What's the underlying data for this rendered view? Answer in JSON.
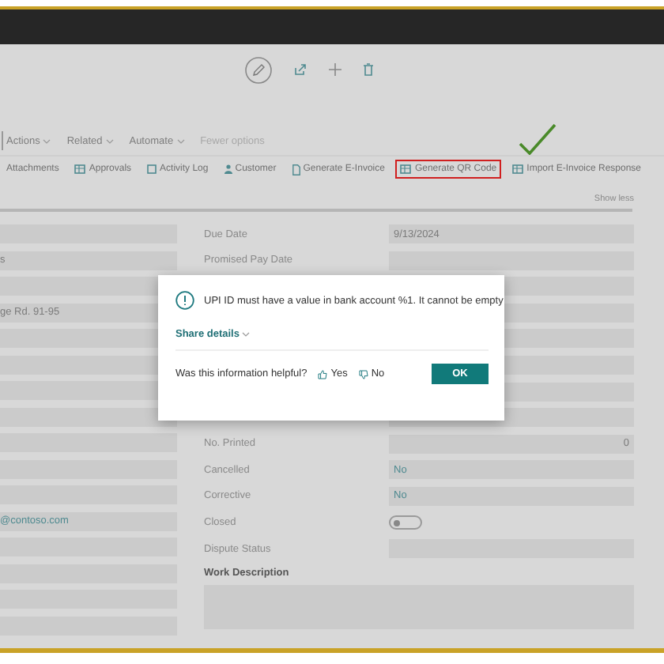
{
  "menu": [
    {
      "label": "Actions"
    },
    {
      "label": "Related"
    },
    {
      "label": "Automate"
    }
  ],
  "fewer_options": "Fewer options",
  "actions": [
    {
      "label": "Attachments",
      "kind": "plain",
      "highlighted": false
    },
    {
      "label": "Approvals",
      "kind": "grid",
      "highlighted": false
    },
    {
      "label": "Activity Log",
      "kind": "square",
      "highlighted": false
    },
    {
      "label": "Customer",
      "kind": "person",
      "highlighted": false
    },
    {
      "label": "Generate E-Invoice",
      "kind": "page",
      "highlighted": false
    },
    {
      "label": "Generate QR Code",
      "kind": "grid",
      "highlighted": true
    },
    {
      "label": "Import E-Invoice Response",
      "kind": "grid",
      "highlighted": false
    }
  ],
  "show_less": "Show less",
  "left_fields": [
    {
      "kind": "text"
    },
    {
      "kind": "text",
      "value": "s"
    },
    {
      "kind": "text"
    },
    {
      "kind": "text",
      "value": "ge Rd. 91-95"
    },
    {
      "kind": "text"
    },
    {
      "kind": "text"
    },
    {
      "kind": "text"
    },
    {
      "kind": "text"
    },
    {
      "kind": "text"
    },
    {
      "kind": "text"
    },
    {
      "kind": "text"
    },
    {
      "kind": "link",
      "value": "@contoso.com"
    },
    {
      "kind": "text"
    },
    {
      "kind": "text"
    },
    {
      "kind": "text"
    },
    {
      "kind": "text"
    }
  ],
  "right_fields": [
    {
      "kind": "text",
      "label": "Due Date",
      "value": "9/13/2024"
    },
    {
      "kind": "text",
      "label": "Promised Pay Date"
    },
    {
      "kind": "text"
    },
    {
      "kind": "text"
    },
    {
      "kind": "text"
    },
    {
      "kind": "text"
    },
    {
      "kind": "text"
    },
    {
      "kind": "text"
    },
    {
      "kind": "number",
      "label": "No. Printed",
      "value": "0"
    },
    {
      "kind": "link",
      "label": "Cancelled",
      "value": "No"
    },
    {
      "kind": "link",
      "label": "Corrective",
      "value": "No"
    },
    {
      "kind": "toggle",
      "label": "Closed",
      "on": false
    },
    {
      "kind": "text",
      "label": "Dispute Status"
    }
  ],
  "work_description": {
    "label": "Work Description"
  },
  "dialog": {
    "message": "UPI ID must have a value in bank account %1. It cannot be empty",
    "share_details": "Share details",
    "question": "Was this information helpful?",
    "yes": "Yes",
    "no": "No",
    "ok": "OK"
  }
}
